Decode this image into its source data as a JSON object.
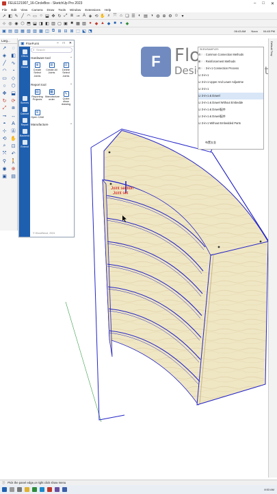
{
  "window": {
    "title": "FELE121907_16-CircleBox - SketchUp Pro 2023",
    "controls": [
      "–",
      "□",
      "✕"
    ]
  },
  "menu": [
    "File",
    "Edit",
    "View",
    "Camera",
    "Draw",
    "Tools",
    "Window",
    "Extensions",
    "Help"
  ],
  "toolbar_status": {
    "time": "06:43 AM",
    "label": "Noon",
    "time2": "04:45 PM"
  },
  "left_tools": {
    "header": "Larg..."
  },
  "plugin": {
    "title": "FloeFurni",
    "search_placeholder": "Search",
    "rail": [
      "Offers",
      "Global",
      "Scenes",
      "Cabinet",
      "Report",
      "Backend",
      "Extend"
    ],
    "sections": [
      {
        "name": "Hardware tool",
        "items": [
          "Create Select Joints",
          "Create All Joints",
          "Delete Select Joints"
        ]
      },
      {
        "name": "Report tool",
        "items": [
          "Reporting Projects",
          "Manufacture order",
          "Quick show drawing",
          "Open CAM"
        ]
      },
      {
        "name": "Manufacture",
        "items": []
      }
    ],
    "copyright": "© WoodWood, 2024"
  },
  "brand": {
    "name": "Floefurni",
    "tagline": "Design.Click.Create"
  },
  "outliner": {
    "header": "SKEWSAMPLES",
    "rows": [
      "⊟ 🗁 Common Connection Methods",
      "  ⊞ 🗁 Reinforcement Methods",
      "  ⊟ 🗁 3-in-1 Connection Process",
      "     ☑ 3-in-1",
      "     ☑ 3-in-1 Upper And Lower Adjustme",
      "     ☑ 3-in-1",
      "     ☑ 3-in-1 & Dowel",
      "     ☑ 3-in-1 & Dowel Without Embedde",
      "     ☑ 3-in-1 & Dowel配件",
      "     ☑ 3-in-1 & Dowel配件",
      "     ☑ 3-in-1 Without Embedded Parts"
    ],
    "selected_index": 6,
    "footer": "布置五金"
  },
  "scene": {
    "joint_label_1": "Joint section",
    "joint_label_2": "Joint set"
  },
  "right_strip": {
    "label": "Default Tray"
  },
  "statusbar": {
    "hint": "Pick the panel edge,or right click show menu"
  },
  "taskbar": {
    "clock": "8:53 AM"
  },
  "colors": {
    "accent": "#1f5fb0",
    "selection": "#2323c8",
    "wood": "#efe6c4"
  }
}
